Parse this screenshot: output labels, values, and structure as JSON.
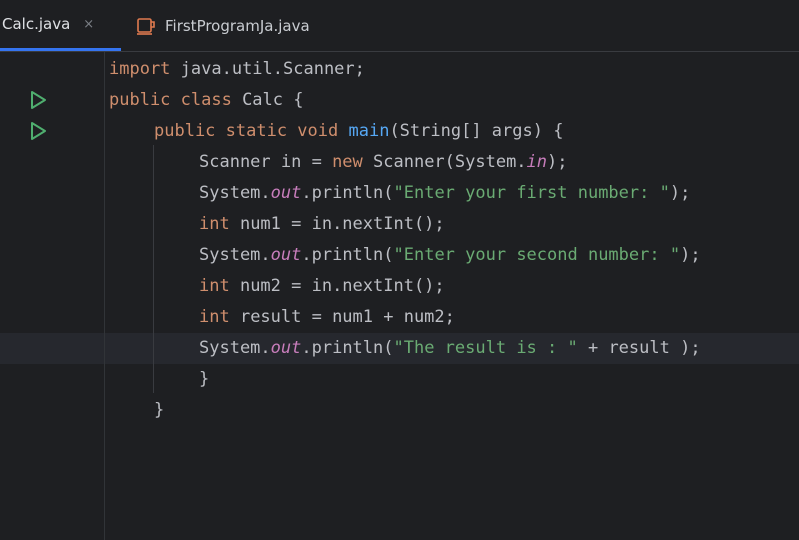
{
  "tabs": [
    {
      "label": "Calc.java",
      "active": true,
      "close": "×",
      "icon": "none"
    },
    {
      "label": "FirstProgramJa.java",
      "active": false,
      "icon": "java-cup-icon"
    }
  ],
  "colors": {
    "background": "#1e1f22",
    "keyword": "#cf8e6d",
    "method": "#56a8f5",
    "string": "#6aab73",
    "static_field": "#c77dbb",
    "default_text": "#bcbec4",
    "run_icon": "#4fae6f",
    "active_tab_underline": "#3574f0"
  },
  "editor": {
    "run_gutter_icons": [
      "run-icon",
      "run-icon"
    ],
    "lines": [
      {
        "t1": "import",
        "t2": " java.util.Scanner;"
      },
      {
        "t1": "public class",
        "t2": " Calc {"
      },
      {
        "t1": "public static void",
        "t2": " ",
        "t3": "main",
        "t4": "(String[] args) {"
      },
      {
        "t1": "Scanner in = ",
        "t2": "new",
        "t3": " Scanner(System.",
        "t4": "in",
        "t5": ");"
      },
      {
        "t1": "System.",
        "t2": "out",
        "t3": ".println(",
        "t4": "\"Enter your first number: \"",
        "t5": ");"
      },
      {
        "t1": "int",
        "t2": " num1 = in.nextInt();"
      },
      {
        "t1": "System.",
        "t2": "out",
        "t3": ".println(",
        "t4": "\"Enter your second number: \"",
        "t5": ");"
      },
      {
        "t1": "int",
        "t2": " num2 = in.nextInt();"
      },
      {
        "t1": "int",
        "t2": " result = num1 + num2;"
      },
      {
        "t1": "System.",
        "t2": "out",
        "t3": ".println(",
        "t4": "\"The result is : \"",
        "t5": " + result );"
      },
      {
        "t1": "}"
      },
      {
        "t1": "}"
      }
    ]
  }
}
